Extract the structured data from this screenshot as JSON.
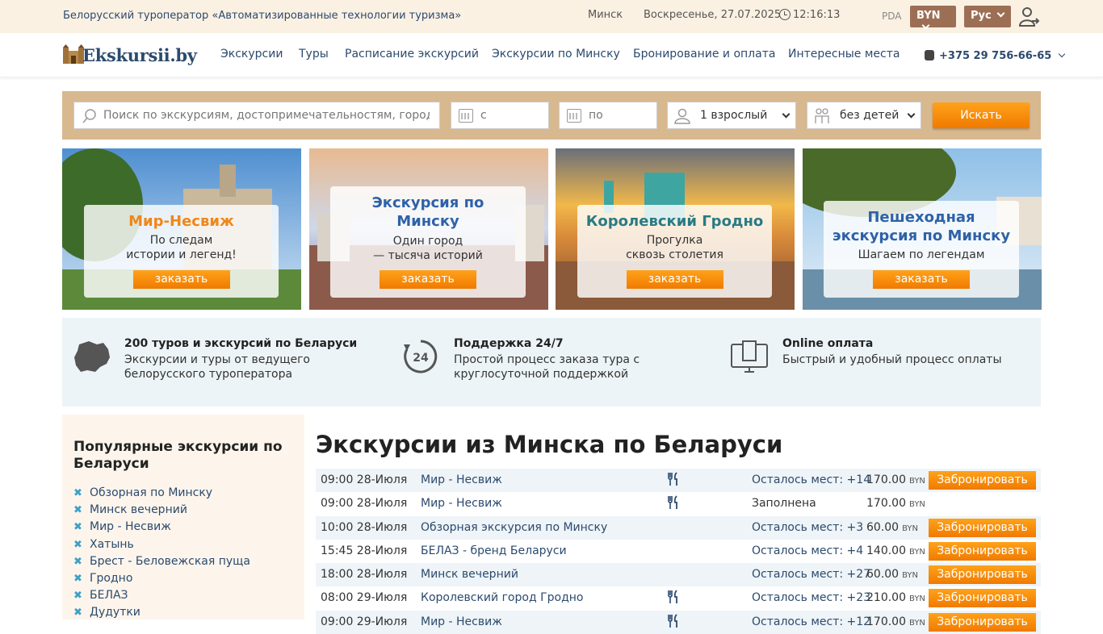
{
  "topbar": {
    "org": "Белорусский туроператор «Автоматизированные технологии туризма»",
    "city": "Минск",
    "date": "Воскресенье, 27.07.2025",
    "time": "12:16:13",
    "pda": "PDA",
    "currency": "BYN",
    "language": "Рус"
  },
  "header": {
    "logo": "Ekskursii.by",
    "nav": [
      "Экскурсии",
      "Туры",
      "Расписание экскурсий",
      "Экскурсии по Минску",
      "Бронирование и оплата",
      "Интересные места"
    ],
    "phone": "+375 29 756-66-65"
  },
  "search": {
    "placeholder": "Поиск по экскурсиям, достопримечательностям, городам",
    "date_from": "с",
    "date_to": "по",
    "adults": "1 взрослый",
    "children": "без детей",
    "button": "Искать"
  },
  "cards": [
    {
      "title": "Мир-Несвиж",
      "sub1": "По следам",
      "sub2": "истории и легенд!",
      "button": "заказать",
      "title_color": "#f0861a"
    },
    {
      "title1": "Экскурсия по",
      "title2": "Минску",
      "sub1": "Один город",
      "sub2": "— тысяча историй",
      "button": "заказать",
      "title_color": "#2e62a8"
    },
    {
      "title": "Королевский Гродно",
      "sub1": "Прогулка",
      "sub2": "сквозь столетия",
      "button": "заказать",
      "title_color": "#2a7b85"
    },
    {
      "title1": "Пешеходная",
      "title2": "экскурсия по Минску",
      "sub1": "Шагаем по легендам",
      "button": "заказать",
      "title_color": "#2e62a8"
    }
  ],
  "features": [
    {
      "heading": "200 туров и экскурсий по Беларуси",
      "line1": "Экскурсии и туры от ведущего",
      "line2": "белорусского туроператора",
      "icon": "belarus-map-icon"
    },
    {
      "heading": "Поддержка 24/7",
      "line1": "Простой процесс заказа тура с",
      "line2": "круглосуточной поддержкой",
      "icon": "support-24-icon"
    },
    {
      "heading": "Online оплата",
      "line1": "Быстрый и удобный процесс оплаты",
      "icon": "computer-payment-icon"
    }
  ],
  "sidebar": {
    "title": "Популярные экскурсии по Беларуси",
    "items": [
      "Обзорная по Минску",
      "Минск вечерний",
      "Мир - Несвиж",
      "Хатынь",
      "Брест - Беловежская пуща",
      "Гродно",
      "БЕЛАЗ",
      "Дудутки"
    ]
  },
  "main": {
    "title": "Экскурсии из Минска по Беларуси",
    "currency": "BYN",
    "book_label": "Забронировать",
    "rows": [
      {
        "time": "09:00 28-Июля",
        "name": "Мир - Несвиж",
        "food": true,
        "left": "Осталось мест: +14",
        "price": "170.00",
        "bookable": true
      },
      {
        "time": "09:00 28-Июля",
        "name": "Мир - Несвиж",
        "food": true,
        "left": "Заполнена",
        "price": "170.00",
        "bookable": false
      },
      {
        "time": "10:00 28-Июля",
        "name": "Обзорная экскурсия по Минску",
        "food": false,
        "left": "Осталось мест: +3",
        "price": "60.00",
        "bookable": true
      },
      {
        "time": "15:45 28-Июля",
        "name": "БЕЛАЗ - бренд Беларуси",
        "food": false,
        "left": "Осталось мест: +4",
        "price": "140.00",
        "bookable": true
      },
      {
        "time": "18:00 28-Июля",
        "name": "Минск вечерний",
        "food": false,
        "left": "Осталось мест: +27",
        "price": "60.00",
        "bookable": true
      },
      {
        "time": "08:00 29-Июля",
        "name": "Королевский город Гродно",
        "food": true,
        "left": "Осталось мест: +23",
        "price": "210.00",
        "bookable": true
      },
      {
        "time": "09:00 29-Июля",
        "name": "Мир - Несвиж",
        "food": true,
        "left": "Осталось мест: +12",
        "price": "170.00",
        "bookable": true
      }
    ]
  }
}
